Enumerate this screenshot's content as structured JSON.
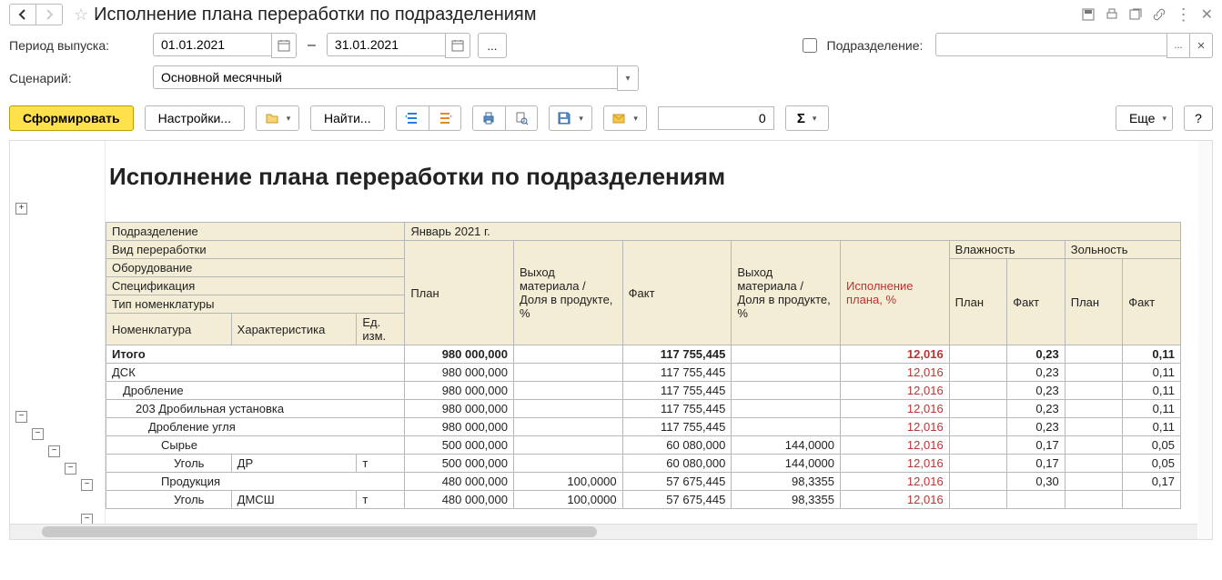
{
  "title": "Исполнение плана переработки по подразделениям",
  "filters": {
    "period_label": "Период выпуска:",
    "date_from": "01.01.2021",
    "date_to": "31.01.2021",
    "department_label": "Подразделение:",
    "department_value": "",
    "ellipsis": "...",
    "scenario_label": "Сценарий:",
    "scenario_value": "Основной месячный"
  },
  "toolbar": {
    "generate": "Сформировать",
    "settings": "Настройки...",
    "find": "Найти...",
    "sum_input": "0",
    "more": "Еще",
    "help": "?"
  },
  "icons": {
    "sigma": "Σ"
  },
  "report": {
    "title": "Исполнение плана переработки по подразделениям",
    "period_header": "Январь 2021 г.",
    "row_labels": {
      "department": "Подразделение",
      "proc_type": "Вид переработки",
      "equipment": "Оборудование",
      "spec": "Спецификация",
      "nom_type": "Тип номенклатуры",
      "nomenclature": "Номенклатура",
      "characteristic": "Характеристика",
      "unit": "Ед. изм."
    },
    "col_headers": {
      "plan": "План",
      "yield1": "Выход материала / Доля в продукте, %",
      "fact": "Факт",
      "yield2": "Выход материала / Доля в продукте, %",
      "execution": "Исполнение плана, %",
      "humidity": "Влажность",
      "ash": "Зольность",
      "sub_plan": "План",
      "sub_fact": "Факт"
    },
    "rows": {
      "total": {
        "label": "Итого",
        "plan": "980 000,000",
        "fact": "117 755,445",
        "exec": "12,016",
        "hum_fact": "0,23",
        "ash_fact": "0,11"
      },
      "dsk": {
        "label": "ДСК",
        "plan": "980 000,000",
        "fact": "117 755,445",
        "exec": "12,016",
        "hum_fact": "0,23",
        "ash_fact": "0,11"
      },
      "crush": {
        "label": "Дробление",
        "plan": "980 000,000",
        "fact": "117 755,445",
        "exec": "12,016",
        "hum_fact": "0,23",
        "ash_fact": "0,11"
      },
      "unit203": {
        "label": "203 Дробильная установка",
        "plan": "980 000,000",
        "fact": "117 755,445",
        "exec": "12,016",
        "hum_fact": "0,23",
        "ash_fact": "0,11"
      },
      "coal_crush": {
        "label": "Дробление угля",
        "plan": "980 000,000",
        "fact": "117 755,445",
        "exec": "12,016",
        "hum_fact": "0,23",
        "ash_fact": "0,11"
      },
      "raw": {
        "label": "Сырье",
        "plan": "500 000,000",
        "fact": "60 080,000",
        "yield2": "144,0000",
        "exec": "12,016",
        "hum_fact": "0,17",
        "ash_fact": "0,05"
      },
      "raw_nom": {
        "nom": "Уголь",
        "char": "ДР",
        "unit": "т",
        "plan": "500 000,000",
        "fact": "60 080,000",
        "yield2": "144,0000",
        "exec": "12,016",
        "hum_fact": "0,17",
        "ash_fact": "0,05"
      },
      "prod": {
        "label": "Продукция",
        "plan": "480 000,000",
        "yield1": "100,0000",
        "fact": "57 675,445",
        "yield2": "98,3355",
        "exec": "12,016",
        "hum_fact": "0,30",
        "ash_fact": "0,17"
      },
      "prod_nom": {
        "nom": "Уголь",
        "char": "ДМСШ",
        "unit": "т",
        "plan": "480 000,000",
        "yield1": "100,0000",
        "fact": "57 675,445",
        "yield2": "98,3355",
        "exec": "12,016"
      }
    }
  }
}
